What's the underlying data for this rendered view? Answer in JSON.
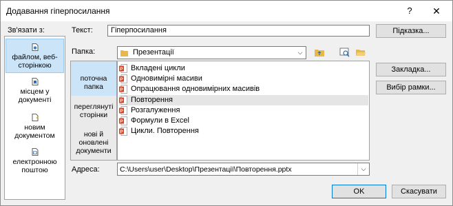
{
  "window": {
    "title": "Додавання гіперпосилання",
    "help": "?",
    "close": "✕"
  },
  "link_to": {
    "label": "Зв'язати з:",
    "items": [
      {
        "label": "файлом, веб-сторінкою",
        "icon": "web-file-icon",
        "selected": true
      },
      {
        "label": "місцем у документі",
        "icon": "place-in-document-icon",
        "selected": false
      },
      {
        "label": "новим документом",
        "icon": "new-document-icon",
        "selected": false
      },
      {
        "label": "електронною поштою",
        "icon": "email-icon",
        "selected": false
      }
    ]
  },
  "text_field": {
    "label": "Текст:",
    "value": "Гіперпосилання"
  },
  "tooltip_button": "Підказка...",
  "folder": {
    "label": "Папка:",
    "value": "Презентації"
  },
  "nav": {
    "items": [
      {
        "label": "поточна папка",
        "selected": true
      },
      {
        "label": "переглянуті сторінки",
        "selected": false
      },
      {
        "label": "нові й оновлені документи",
        "selected": false
      }
    ]
  },
  "files": [
    {
      "name": "Вкладені цикли",
      "highlighted": false
    },
    {
      "name": "Одновимірні масиви",
      "highlighted": false
    },
    {
      "name": "Опрацювання одновимірних  масивів",
      "highlighted": false
    },
    {
      "name": "Повторення",
      "highlighted": true
    },
    {
      "name": "Розгалуження",
      "highlighted": false
    },
    {
      "name": "Формули в Excel",
      "highlighted": false
    },
    {
      "name": "Цикли. Повторення",
      "highlighted": false
    }
  ],
  "bookmark_button": "Закладка...",
  "frame_button": "Вибір рамки...",
  "address": {
    "label": "Адреса:",
    "value": "C:\\Users\\user\\Desktop\\Презентації\\Повторення.pptx"
  },
  "ok_button": "OK",
  "cancel_button": "Скасувати",
  "colors": {
    "accent": "#0078d7",
    "selection": "#cce4f7",
    "ppt": "#d24726"
  }
}
